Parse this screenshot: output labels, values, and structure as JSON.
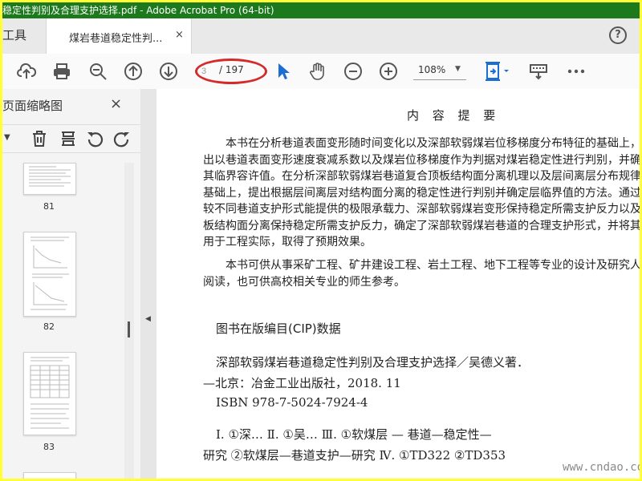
{
  "window": {
    "title": "稳定性判别及合理支护选择.pdf - Adobe Acrobat Pro (64-bit)"
  },
  "tabs": {
    "tools_label": "工具",
    "doc_label": "煤岩巷道稳定性判...",
    "close": "×",
    "help": "?"
  },
  "toolbar": {
    "icons": [
      "upload-icon",
      "print-icon",
      "zoom-search-icon",
      "page-up-icon",
      "page-down-icon",
      "select-cursor-icon",
      "hand-tool-icon",
      "zoom-out-icon",
      "zoom-in-icon",
      "fit-page-icon",
      "keyboard-icon",
      "more-icon"
    ],
    "page_current": "3",
    "page_total": "/ 197",
    "zoom": "108%"
  },
  "sidebar": {
    "title": "页面缩略图",
    "close": "×",
    "thumbnails": [
      {
        "label": "81"
      },
      {
        "label": "82"
      },
      {
        "label": "83"
      }
    ]
  },
  "document": {
    "heading": "内 容 提 要",
    "abstract_para1": "本书在分析巷道表面变形随时间变化以及深部软弱煤岩位移梯度分布特征的基础上，提出以巷道表面变形速度衰减系数以及煤岩位移梯度作为判据对煤岩稳定性进行判别，并确定其临界容许值。在分析深部软弱煤岩巷道复合顶板结构面分离机理以及层间离层分布规律的基础上，提出根据层间离层对结构面分离的稳定性进行判别并确定层临界值的方法。通过比较不同巷道支护形式能提供的极限承载力、深部软弱煤岩变形保持稳定所需支护反力以及顶板结构面分离保持稳定所需支护反力，确定了深部软弱煤岩巷道的合理支护形式，并将其应用于工程实际，取得了预期效果。",
    "abstract_para2": "本书可供从事采矿工程、矿井建设工程、岩土工程、地下工程等专业的设计及研究人员阅读，也可供高校相关专业的师生参考。",
    "cip_heading": "图书在版编目(CIP)数据",
    "cip_line1": "深部软弱煤岩巷道稳定性判别及合理支护选择／吴德义著．",
    "cip_line2": "—北京：冶金工业出版社，2018. 11",
    "cip_line3": "ISBN 978-7-5024-7924-4",
    "cip_line4": "Ⅰ. ①深…   Ⅱ. ①吴…   Ⅲ. ①软煤层 — 巷道—稳定性—",
    "cip_line5": "研究   ②软煤层—巷道支护—研究   Ⅳ. ①TD322   ②TD353",
    "watermark": "www.cndao.com"
  },
  "colors": {
    "titlebar": "#1c7a1c",
    "annotation_oval": "#d42a2a",
    "frame": "#ffff33",
    "cursor": "#1a6fd1"
  }
}
